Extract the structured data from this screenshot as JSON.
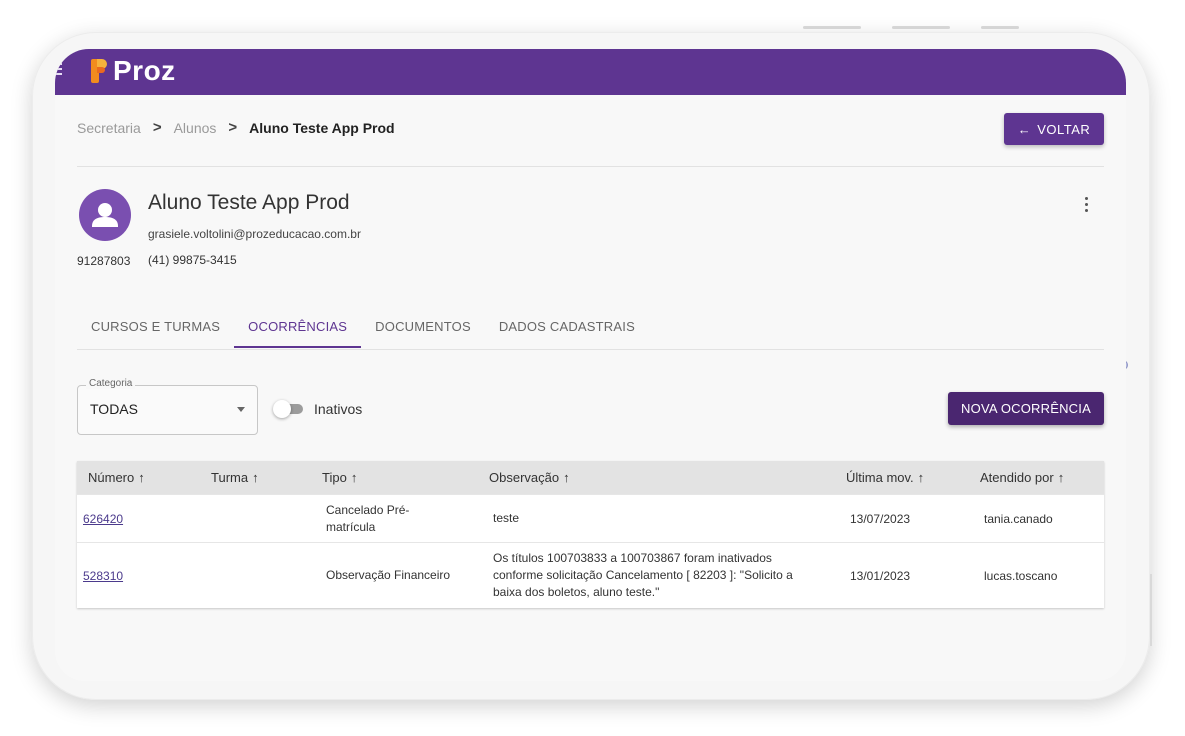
{
  "app": {
    "logo_text": "Proz"
  },
  "breadcrumb": {
    "items": [
      "Secretaria",
      "Alunos"
    ],
    "current": "Aluno Teste App Prod",
    "separator": ">"
  },
  "header": {
    "back_label": "VOLTAR"
  },
  "student": {
    "name": "Aluno Teste App Prod",
    "email": "grasiele.voltolini@prozeducacao.com.br",
    "id": "91287803",
    "phone": "(41) 99875-3415"
  },
  "tabs": [
    {
      "label": "CURSOS E TURMAS",
      "active": false
    },
    {
      "label": "OCORRÊNCIAS",
      "active": true
    },
    {
      "label": "DOCUMENTOS",
      "active": false
    },
    {
      "label": "DADOS CADASTRAIS",
      "active": false
    }
  ],
  "filters": {
    "category_label": "Categoria",
    "category_value": "TODAS",
    "inactive_label": "Inativos",
    "inactive_on": false
  },
  "actions": {
    "new_label": "NOVA OCORRÊNCIA"
  },
  "table": {
    "sort_arrow": "↑",
    "columns": [
      "Número",
      "Turma",
      "Tipo",
      "Observação",
      "Última mov.",
      "Atendido por"
    ],
    "rows": [
      {
        "numero": "626420",
        "turma": "",
        "tipo": "Cancelado Pré-matrícula",
        "observacao": "teste",
        "ultima_mov": "13/07/2023",
        "atendido_por": "tania.canado"
      },
      {
        "numero": "528310",
        "turma": "",
        "tipo": "Observação Financeiro",
        "observacao": "Os títulos 100703833 a 100703867 foram inativados conforme solicitação Cancelamento [ 82203 ]: \"Solicito a baixa dos boletos, aluno teste.\"",
        "ultima_mov": "13/01/2023",
        "atendido_por": "lucas.toscano"
      }
    ]
  },
  "colors": {
    "brand": "#5e3591",
    "brand_dark": "#4a2670",
    "logo_orange": "#f28c1e"
  },
  "icons": [
    "menu-icon",
    "arrow-left-icon",
    "person-icon",
    "more-vert-icon",
    "dropdown-caret-icon",
    "sort-arrow-icon"
  ]
}
